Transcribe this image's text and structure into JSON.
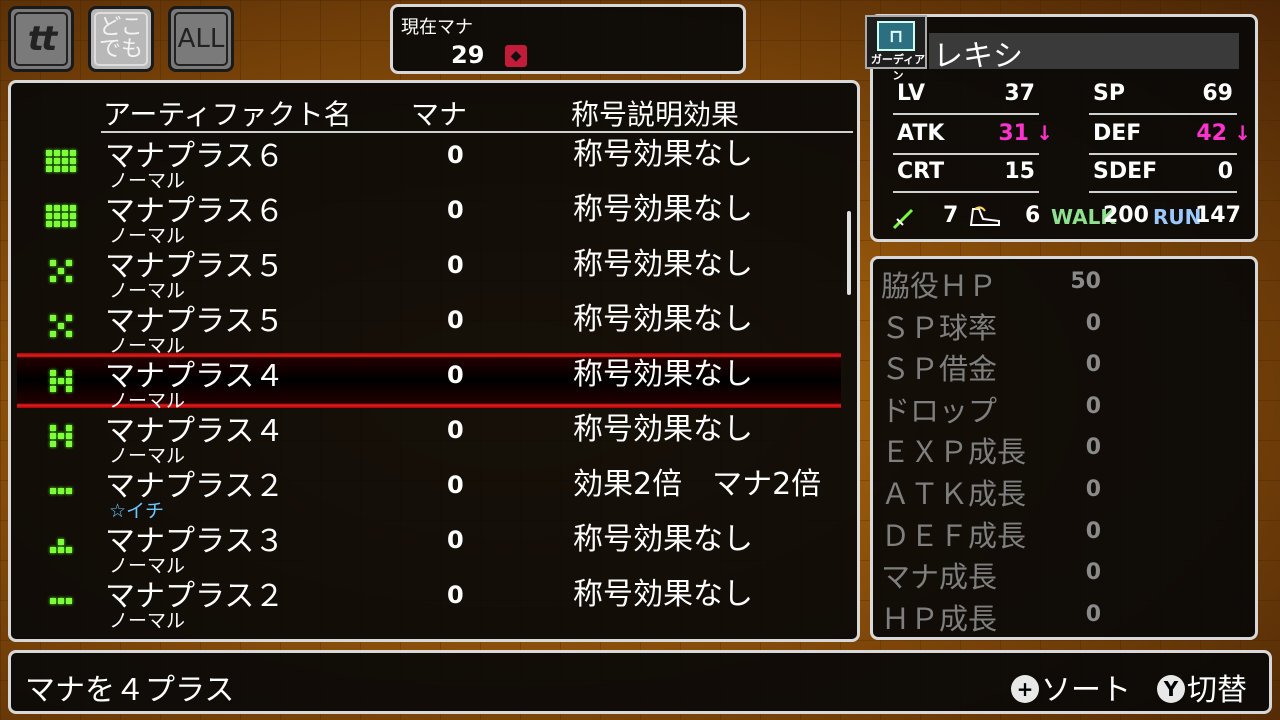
{
  "tabs": [
    {
      "label": "tt"
    },
    {
      "label_top": "どこ",
      "label_bottom": "でも"
    },
    {
      "label": "ALL"
    }
  ],
  "mana": {
    "label": "現在マナ",
    "value": "29"
  },
  "list": {
    "headers": {
      "name": "アーティファクト名",
      "mana": "マナ",
      "effect": "称号説明効果"
    },
    "rows": [
      {
        "name": "マナプラス６",
        "sub": "ノーマル",
        "mana": "0",
        "effect": "称号効果なし",
        "icon": "dots-4x3",
        "selected": false
      },
      {
        "name": "マナプラス６",
        "sub": "ノーマル",
        "mana": "0",
        "effect": "称号効果なし",
        "icon": "dots-4x3",
        "selected": false
      },
      {
        "name": "マナプラス５",
        "sub": "ノーマル",
        "mana": "0",
        "effect": "称号効果なし",
        "icon": "dots-x",
        "selected": false
      },
      {
        "name": "マナプラス５",
        "sub": "ノーマル",
        "mana": "0",
        "effect": "称号効果なし",
        "icon": "dots-x",
        "selected": false
      },
      {
        "name": "マナプラス４",
        "sub": "ノーマル",
        "mana": "0",
        "effect": "称号効果なし",
        "icon": "dots-3x3",
        "selected": true
      },
      {
        "name": "マナプラス４",
        "sub": "ノーマル",
        "mana": "0",
        "effect": "称号効果なし",
        "icon": "dots-3x3",
        "selected": false
      },
      {
        "name": "マナプラス２",
        "sub": "☆イチ",
        "mana": "0",
        "effect": "効果2倍　マナ2倍",
        "icon": "dots-2",
        "selected": false
      },
      {
        "name": "マナプラス３",
        "sub": "ノーマル",
        "mana": "0",
        "effect": "称号効果なし",
        "icon": "dots-tri",
        "selected": false
      },
      {
        "name": "マナプラス２",
        "sub": "ノーマル",
        "mana": "0",
        "effect": "称号効果なし",
        "icon": "dots-2",
        "selected": false
      }
    ]
  },
  "character": {
    "class_name": "ガーディアン",
    "name": "レキシ",
    "stats": {
      "lv": {
        "label": "LV",
        "value": "37"
      },
      "sp": {
        "label": "SP",
        "value": "69"
      },
      "atk": {
        "label": "ATK",
        "value": "31",
        "arrow": "↓"
      },
      "def": {
        "label": "DEF",
        "value": "42",
        "arrow": "↓"
      },
      "crt": {
        "label": "CRT",
        "value": "15"
      },
      "sdef": {
        "label": "SDEF",
        "value": "0"
      }
    },
    "speed": {
      "sword": "7",
      "shoe": "6",
      "walk_label": "WALK",
      "walk": "200",
      "run_label": "RUN",
      "run": "147"
    }
  },
  "substats": [
    {
      "label": "脇役ＨＰ",
      "value": "50"
    },
    {
      "label": "ＳＰ球率",
      "value": "0"
    },
    {
      "label": "ＳＰ借金",
      "value": "0"
    },
    {
      "label": "ドロップ",
      "value": "0"
    },
    {
      "label": "ＥＸＰ成長",
      "value": "0"
    },
    {
      "label": "ＡＴＫ成長",
      "value": "0"
    },
    {
      "label": "ＤＥＦ成長",
      "value": "0"
    },
    {
      "label": "マナ成長",
      "value": "0"
    },
    {
      "label": "ＨＰ成長",
      "value": "0"
    }
  ],
  "footer": {
    "description": "マナを４プラス",
    "sort_button": "+",
    "sort_label": "ソート",
    "switch_button": "Y",
    "switch_label": "切替"
  },
  "colors": {
    "accent_magenta": "#ff33cc",
    "walk_green": "#8fe08f",
    "run_blue": "#9ac8ff",
    "icon_green": "#7cff3a",
    "selection_red": "#e02020"
  }
}
